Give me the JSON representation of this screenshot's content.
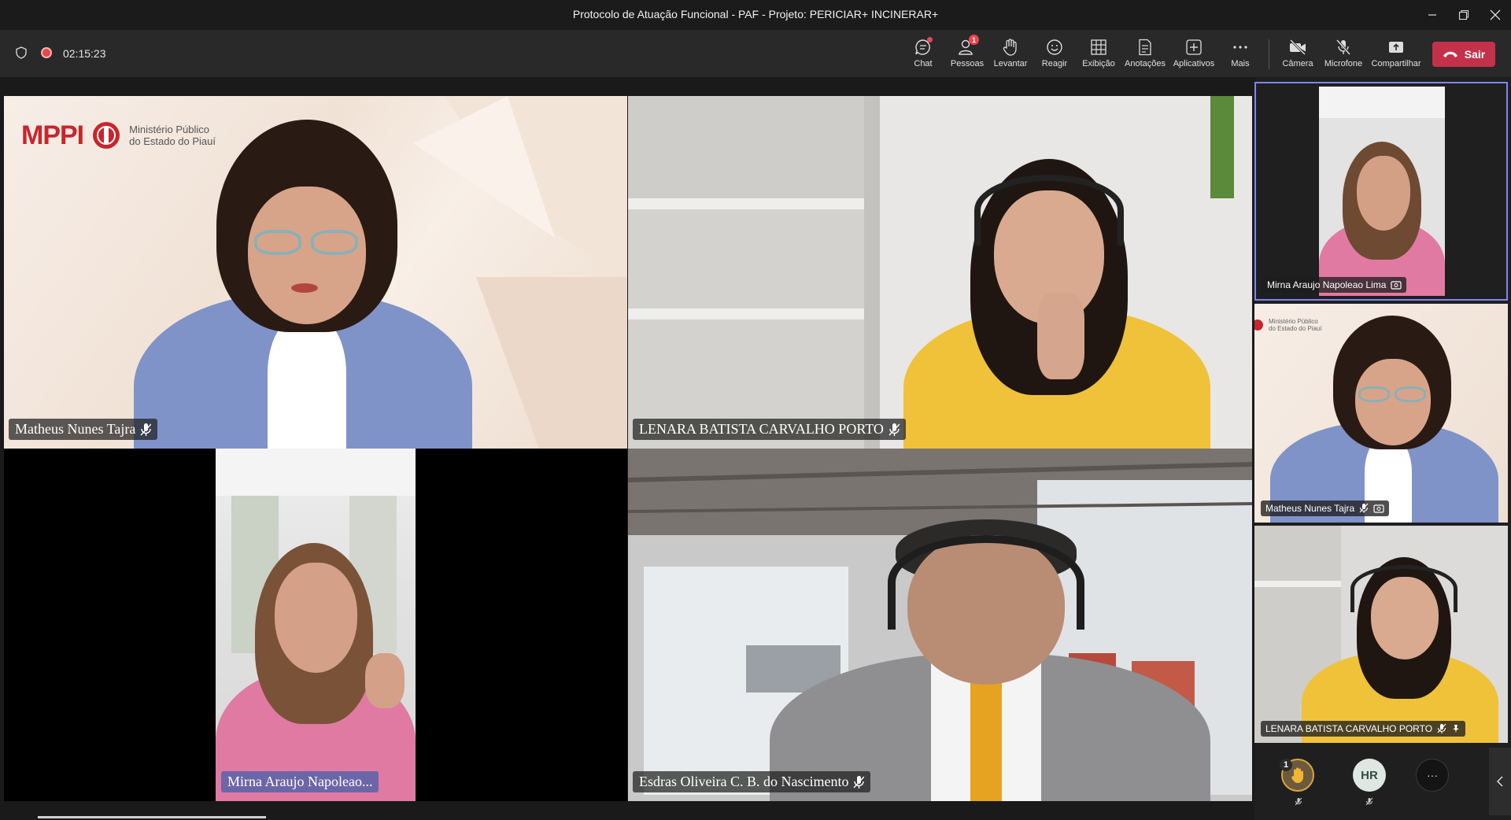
{
  "window": {
    "title": "Protocolo de Atuação Funcional - PAF - Projeto: PERICIAR+ INCINERAR+"
  },
  "meeting": {
    "timer": "02:15:23"
  },
  "toolbar": {
    "chat": "Chat",
    "people": "Pessoas",
    "people_badge": "1",
    "raise": "Levantar",
    "react": "Reagir",
    "view": "Exibição",
    "notes": "Anotações",
    "apps": "Aplicativos",
    "more": "Mais",
    "camera": "Câmera",
    "mic": "Microfone",
    "share": "Compartilhar",
    "leave": "Sair"
  },
  "logo": {
    "brand": "MPPI",
    "line1": "Ministério Público",
    "line2": "do Estado do Piauí"
  },
  "main_tiles": [
    {
      "name": "Matheus Nunes Tajra"
    },
    {
      "name": "LENARA BATISTA CARVALHO PORTO"
    },
    {
      "name": "Mirna Araujo Napoleao..."
    },
    {
      "name": "Esdras Oliveira C. B. do Nascimento"
    }
  ],
  "side_tiles": [
    {
      "name": "Mirna Araujo Napoleao Lima"
    },
    {
      "name": "Matheus Nunes Tajra"
    },
    {
      "name": "LENARA BATISTA CARVALHO PORTO"
    }
  ],
  "side_logo": {
    "line1": "Ministério Público",
    "line2": "do Estado do Piauí"
  },
  "roster": {
    "hand_count": "1",
    "avatar_initials": "HR",
    "more": "···"
  },
  "colors": {
    "accent": "#6264a7",
    "leave": "#c4314b",
    "recording": "#e8474e"
  }
}
